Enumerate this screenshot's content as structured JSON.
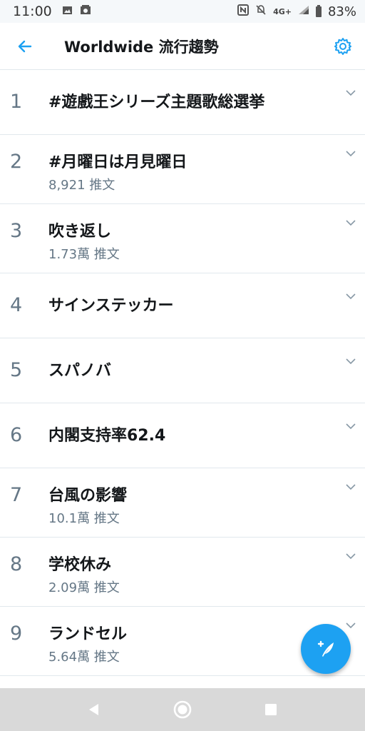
{
  "status_bar": {
    "time": "11:00",
    "network": "4G+",
    "battery_percent": "83%"
  },
  "header": {
    "title": "Worldwide 流行趨勢"
  },
  "trends": [
    {
      "rank": "1",
      "name": "#遊戲王シリーズ主題歌総選挙",
      "count": ""
    },
    {
      "rank": "2",
      "name": "#月曜日は月見曜日",
      "count": "8,921 推文"
    },
    {
      "rank": "3",
      "name": "吹き返し",
      "count": "1.73萬 推文"
    },
    {
      "rank": "4",
      "name": "サインステッカー",
      "count": ""
    },
    {
      "rank": "5",
      "name": "スパノバ",
      "count": ""
    },
    {
      "rank": "6",
      "name": "内閣支持率62.4",
      "count": ""
    },
    {
      "rank": "7",
      "name": "台風の影響",
      "count": "10.1萬 推文"
    },
    {
      "rank": "8",
      "name": "学校休み",
      "count": "2.09萬 推文"
    },
    {
      "rank": "9",
      "name": "ランドセル",
      "count": "5.64萬 推文"
    }
  ],
  "icons": {
    "back": "arrow-left-icon",
    "settings": "gear-icon",
    "chevron": "chevron-down-icon",
    "compose": "compose-tweet-icon",
    "nav_back": "triangle-back-icon",
    "nav_home": "circle-home-icon",
    "nav_recents": "square-recents-icon"
  },
  "colors": {
    "accent": "#1da1f2",
    "secondary_text": "#657786",
    "primary_text": "#14171a",
    "divider": "#e1e8ed"
  }
}
